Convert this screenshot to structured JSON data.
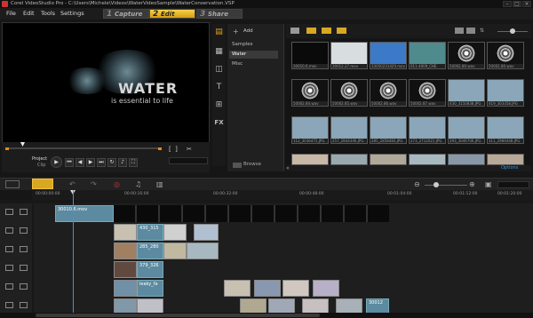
{
  "window": {
    "title": "Corel VideoStudio Pro - C:\\Users\\Michele\\Videos\\WaterVideoSample\\WaterConservation.VSP"
  },
  "menu": [
    "File",
    "Edit",
    "Tools",
    "Settings"
  ],
  "steps": [
    {
      "num": "1",
      "label": "Capture"
    },
    {
      "num": "2",
      "label": "Edit"
    },
    {
      "num": "3",
      "label": "Share"
    }
  ],
  "preview": {
    "title": "WATER",
    "subtitle": "is essential to life"
  },
  "transport": {
    "mode_project": "Project",
    "mode_clip": "Clip"
  },
  "library": {
    "add_label": "Add",
    "folders": [
      "Samples",
      "Water",
      "Misc"
    ],
    "browse_label": "Browse",
    "options_label": "Options"
  },
  "thumbs": [
    {
      "cap": "30010.6.mov",
      "kind": "dark"
    },
    {
      "cap": "30012.27.mov",
      "kind": "light"
    },
    {
      "cap": "33050231420.mov",
      "kind": "blue"
    },
    {
      "cap": "011-4009_CHE",
      "kind": "teal"
    },
    {
      "cap": "50002.80.wav",
      "kind": "disc"
    },
    {
      "cap": "50002.80.wav",
      "kind": "disc"
    },
    {
      "cap": "50002.84.wav",
      "kind": "disc"
    },
    {
      "cap": "50002.85.wav",
      "kind": "disc"
    },
    {
      "cap": "50002.86.wav",
      "kind": "disc"
    },
    {
      "cap": "50002.87.wav",
      "kind": "disc"
    },
    {
      "cap": "430_3150838.JPG",
      "kind": "photo"
    },
    {
      "cap": "419_303358.JPG",
      "kind": "photo"
    },
    {
      "cap": "112_3036475.JPG",
      "kind": "photo"
    },
    {
      "cap": "257_2844346.JPG",
      "kind": "photo"
    },
    {
      "cap": "285_2858483.JPG",
      "kind": "photo"
    },
    {
      "cap": "273_2712021.JPG",
      "kind": "photo"
    },
    {
      "cap": "293_3046706.JPG",
      "kind": "photo"
    },
    {
      "cap": "311_2984448.JPG",
      "kind": "photo"
    }
  ],
  "timeline": {
    "ruler": [
      "00:00:00:00",
      "00:00:16:00",
      "00:00:32:00",
      "00:00:48:00",
      "00:01:04:00",
      "00:01:12:00",
      "00:01:20:00",
      "00:01:28:00"
    ],
    "clips": {
      "video": "30010.6.mov",
      "o1": "430_315",
      "o2": "285_280",
      "o3": "379_326",
      "o4": "leaky_fa",
      "o5": "30012"
    }
  }
}
